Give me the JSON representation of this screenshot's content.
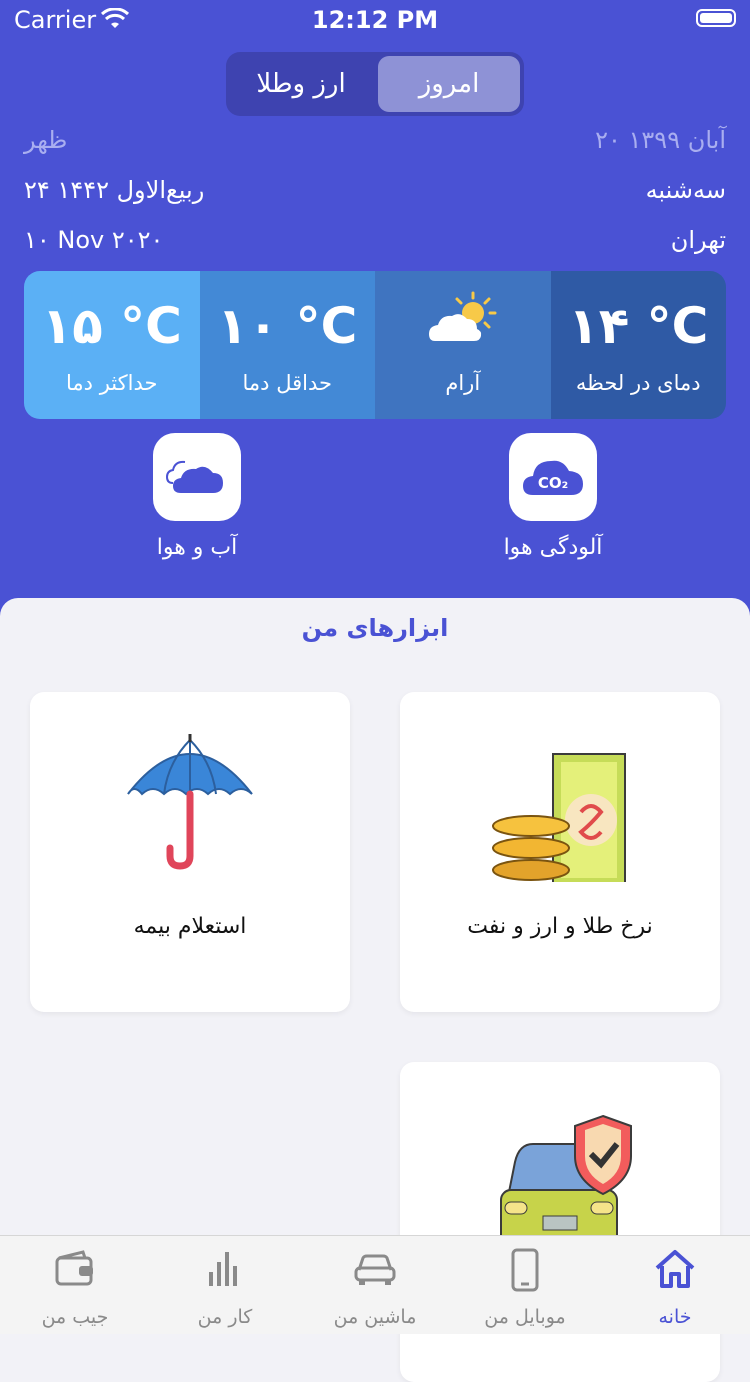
{
  "status_bar": {
    "carrier": "Carrier",
    "time": "12:12 PM"
  },
  "segment": {
    "tabs": [
      "ارز وطلا",
      "امروز"
    ],
    "selected": "امروز"
  },
  "date_info": {
    "period": "ظهر",
    "jalali_date": "۲۰ آبان ۱۳۹۹",
    "hijri_date": "۲۴ ربیع‌الاول ۱۴۴۲",
    "weekday": "سه‌شنبه",
    "gregorian_date": "۱۰ Nov ۲۰۲۰",
    "city": "تهران"
  },
  "weather": {
    "max": {
      "value": "۱۵ °C",
      "label": "حداکثر دما"
    },
    "min": {
      "value": "۱۰ °C",
      "label": "حداقل دما"
    },
    "condition": {
      "label": "آرام",
      "icon": "partly-sunny-icon"
    },
    "current": {
      "value": "۱۴ °C",
      "label": "دمای در لحظه"
    },
    "colors": [
      "#5bb0f5",
      "#4389d6",
      "#3f74c0",
      "#2f5aa5"
    ]
  },
  "quick_actions": [
    {
      "label": "آب و هوا",
      "icon": "cloud-icon"
    },
    {
      "label": "آلودگی هوا",
      "icon": "co2-cloud-icon"
    }
  ],
  "tools": {
    "title": "ابزارهای من",
    "cards": [
      {
        "label": "استعلام بیمه",
        "icon": "umbrella-icon"
      },
      {
        "label": "نرخ طلا و ارز و نفت",
        "icon": "coins-money-icon"
      },
      {
        "label": "",
        "icon": "car-shield-icon"
      }
    ]
  },
  "tab_bar": {
    "items": [
      {
        "label": "جیب من",
        "icon": "wallet-icon"
      },
      {
        "label": "کار من",
        "icon": "bar-chart-icon"
      },
      {
        "label": "ماشین من",
        "icon": "car-icon"
      },
      {
        "label": "موبایل من",
        "icon": "mobile-icon"
      },
      {
        "label": "خانه",
        "icon": "home-icon"
      }
    ],
    "active": "خانه"
  },
  "colors": {
    "brand": "#4a52d4",
    "background": "#f2f2f7"
  }
}
